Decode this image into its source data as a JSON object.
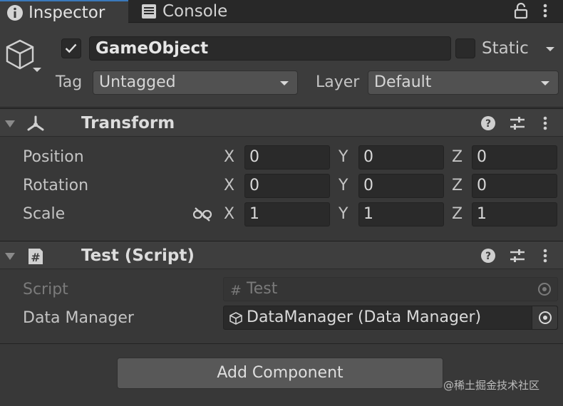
{
  "tabs": {
    "inspector": "Inspector",
    "console": "Console"
  },
  "header": {
    "name": "GameObject",
    "static_label": "Static",
    "tag_label": "Tag",
    "tag_value": "Untagged",
    "layer_label": "Layer",
    "layer_value": "Default"
  },
  "transform": {
    "title": "Transform",
    "rows": [
      {
        "label": "Position",
        "x": "0",
        "y": "0",
        "z": "0"
      },
      {
        "label": "Rotation",
        "x": "0",
        "y": "0",
        "z": "0"
      },
      {
        "label": "Scale",
        "x": "1",
        "y": "1",
        "z": "1"
      }
    ],
    "axes": {
      "x": "X",
      "y": "Y",
      "z": "Z"
    }
  },
  "script_component": {
    "title": "Test (Script)",
    "script_label": "Script",
    "script_value": "Test",
    "field_label": "Data Manager",
    "field_value": "DataManager (Data Manager)"
  },
  "add_component_label": "Add Component",
  "watermark": "@稀土掘金技术社区",
  "colors": {
    "panel": "#383838",
    "tabbar": "#282828",
    "accent": "#3a79bb"
  }
}
